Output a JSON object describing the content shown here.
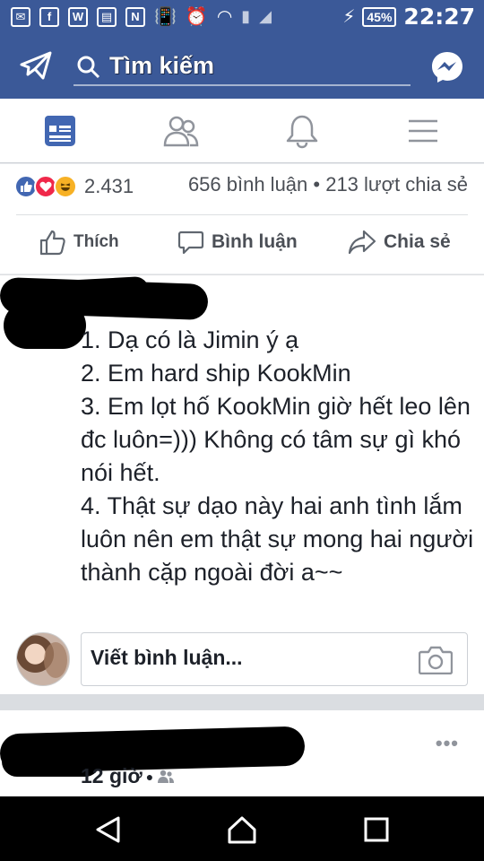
{
  "status_bar": {
    "battery": "45%",
    "time": "22:27"
  },
  "header": {
    "search_placeholder": "Tìm kiếm"
  },
  "tabs": [
    {
      "icon": "news-feed-icon",
      "active": true
    },
    {
      "icon": "friends-icon",
      "active": false
    },
    {
      "icon": "notifications-icon",
      "active": false
    },
    {
      "icon": "menu-icon",
      "active": false
    }
  ],
  "post_summary": {
    "reaction_count": "2.431",
    "counts_text": "656 bình luận • 213 lượt chia sẻ",
    "actions": {
      "like": "Thích",
      "comment": "Bình luận",
      "share": "Chia sẻ"
    }
  },
  "comment": {
    "text": "1. Dạ có là Jimin ý ạ\n2. Em hard ship KookMin\n3. Em lọt hố KookMin giờ hết leo lên đc luôn=))) Không có tâm sự gì khó nói hết.\n4. Thật sự dạo này hai anh tình lắm luôn nên em thật sự mong hai người thành cặp ngoài đời a~~"
  },
  "write_comment": {
    "placeholder": "Viết bình luận..."
  },
  "next_post": {
    "time": "12 giờ"
  },
  "colors": {
    "brand": "#3b5998",
    "accent": "#4267b2"
  }
}
